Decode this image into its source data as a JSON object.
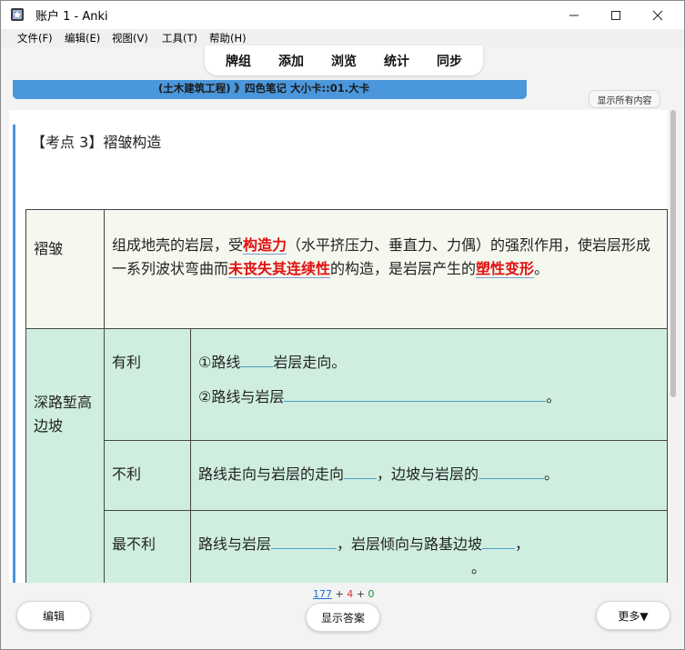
{
  "window": {
    "title": "账户 1 - Anki"
  },
  "menu": [
    "文件(F)",
    "编辑(E)",
    "视图(V)",
    "工具(T)",
    "帮助(H)"
  ],
  "toolbar": [
    "牌组",
    "添加",
    "浏览",
    "统计",
    "同步"
  ],
  "deck": {
    "path": "(土木建筑工程) 》四色笔记 大小卡::01.大卡",
    "show_all": "显示所有内容"
  },
  "card": {
    "title": "【考点 3】褶皱构造",
    "row1": {
      "label": "褶皱",
      "t1": "组成地壳的岩层，受",
      "k1": "构造力",
      "t2": "（水平挤压力、垂直力、力偶）的强烈作用，使岩层形成一系列波状弯曲而",
      "k2": "未丧失其连续性",
      "t3": "的构造，是岩层产生的",
      "k3": "塑性变形",
      "t4": "。"
    },
    "group_label": "深路堑高边坡",
    "adv": {
      "label": "有利",
      "l1a": "①路线",
      "l1b": "岩层走向。",
      "l2a": "②路线与岩层",
      "l2b": "。"
    },
    "dis": {
      "label": "不利",
      "a": "路线走向与岩层的走向",
      "b": "，边坡与岩层的",
      "c": "。"
    },
    "worst": {
      "label": "最不利",
      "a": "路线与岩层",
      "b": "，岩层倾向与路基边坡",
      "c": "，",
      "d": "。"
    }
  },
  "counts": {
    "new": "177",
    "learn": "4",
    "review": "0",
    "plus": "+"
  },
  "buttons": {
    "edit": "编辑",
    "show_answer": "显示答案",
    "more": "更多▼"
  },
  "colors": {
    "accent": "#4a97dc",
    "keyword": "#e01010",
    "row_green": "#cfeee0"
  }
}
